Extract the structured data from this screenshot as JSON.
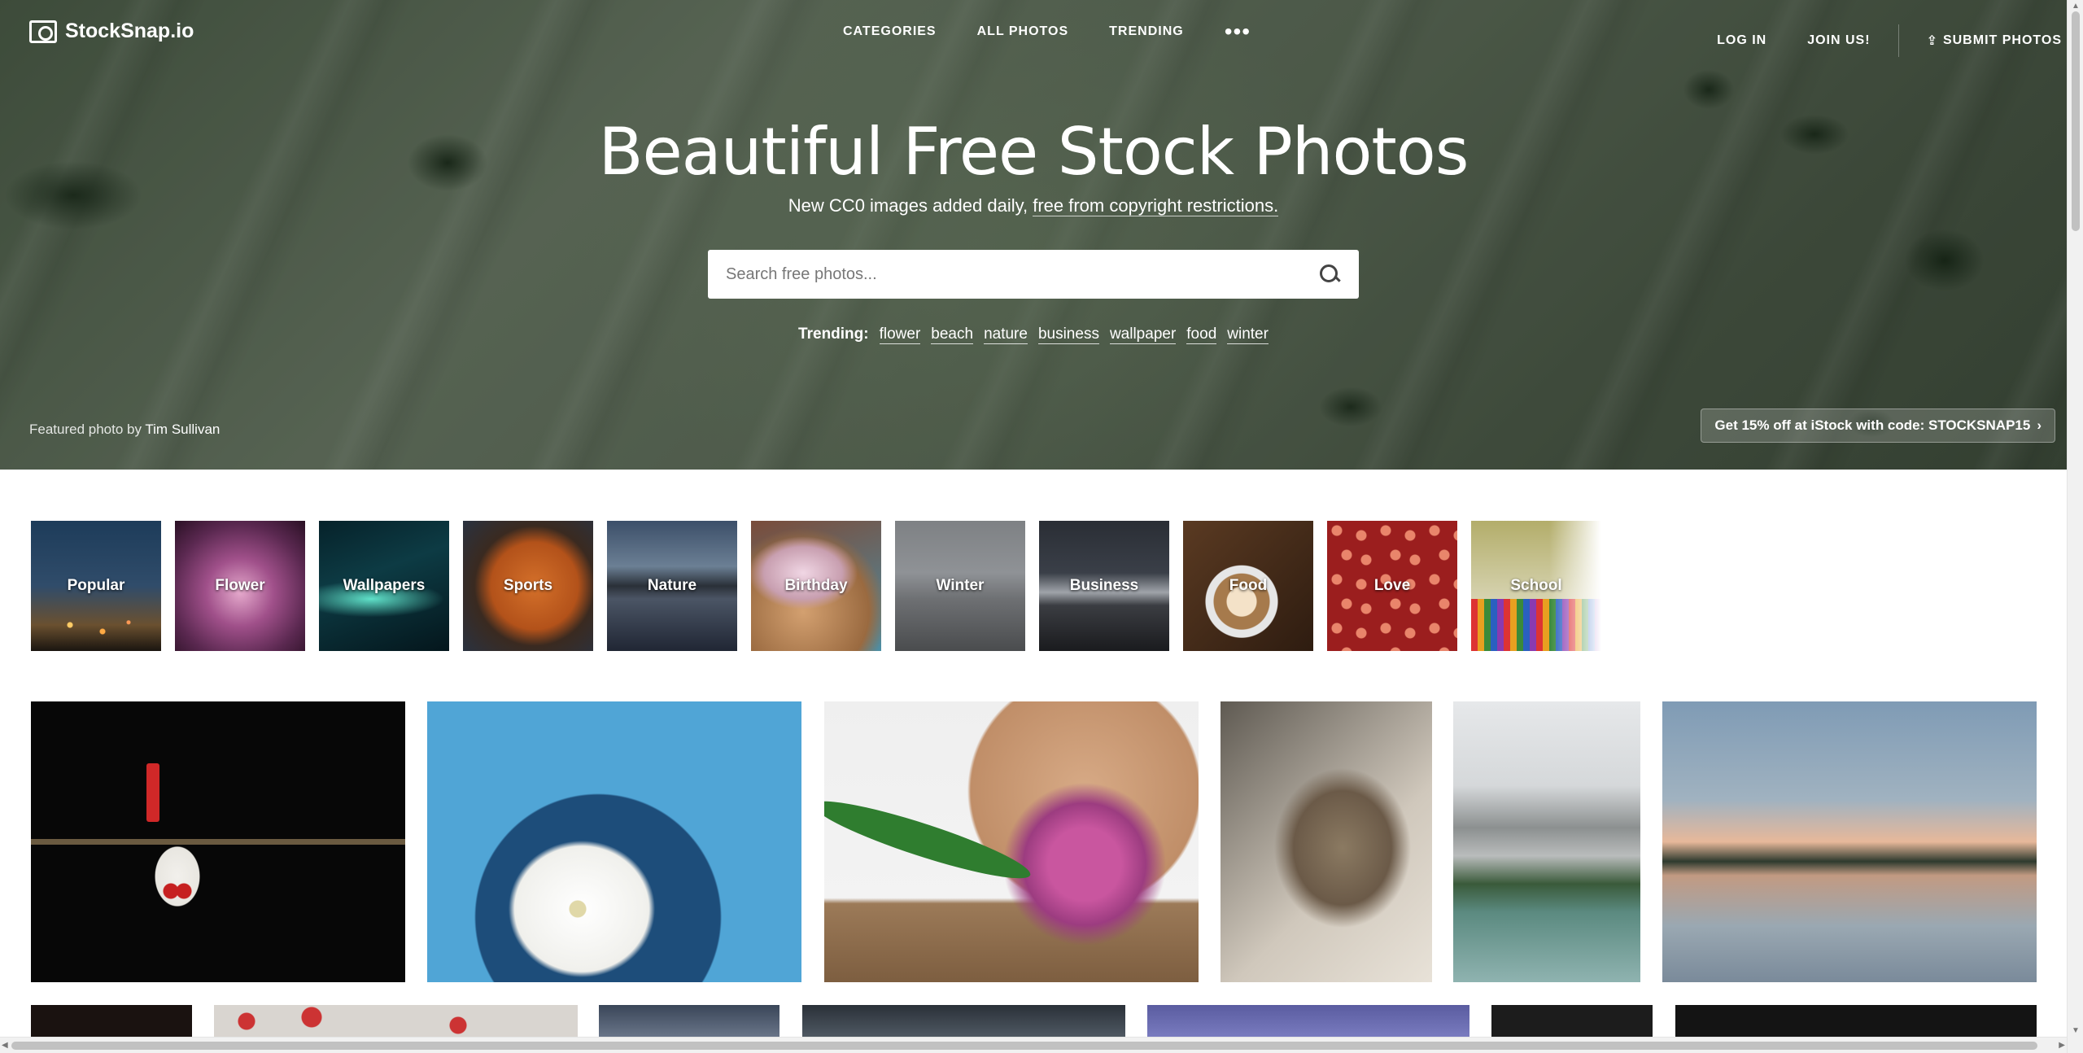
{
  "header": {
    "logo": "StockSnap.io",
    "nav": [
      "CATEGORIES",
      "ALL PHOTOS",
      "TRENDING"
    ],
    "login": "LOG IN",
    "join": "JOIN US!",
    "submit": "SUBMIT PHOTOS"
  },
  "hero": {
    "title": "Beautiful Free Stock Photos",
    "subtitle_prefix": "New CC0 images added daily,",
    "subtitle_link": "free from copyright restrictions.",
    "search_placeholder": "Search free photos...",
    "trending_label": "Trending:",
    "trending_tags": [
      "flower",
      "beach",
      "nature",
      "business",
      "wallpaper",
      "food",
      "winter"
    ],
    "credit_prefix": "Featured photo by",
    "credit_name": "Tim Sullivan",
    "promo": "Get 15% off at iStock with code: STOCKSNAP15"
  },
  "categories": [
    "Popular",
    "Flower",
    "Wallpapers",
    "Sports",
    "Nature",
    "Birthday",
    "Winter",
    "Business",
    "Food",
    "Love",
    "School"
  ],
  "icons": {
    "logo": "camera-icon",
    "more": "more-dots-icon",
    "upload": "upload-icon",
    "search": "search-icon",
    "promo": "chevron-right-icon"
  }
}
